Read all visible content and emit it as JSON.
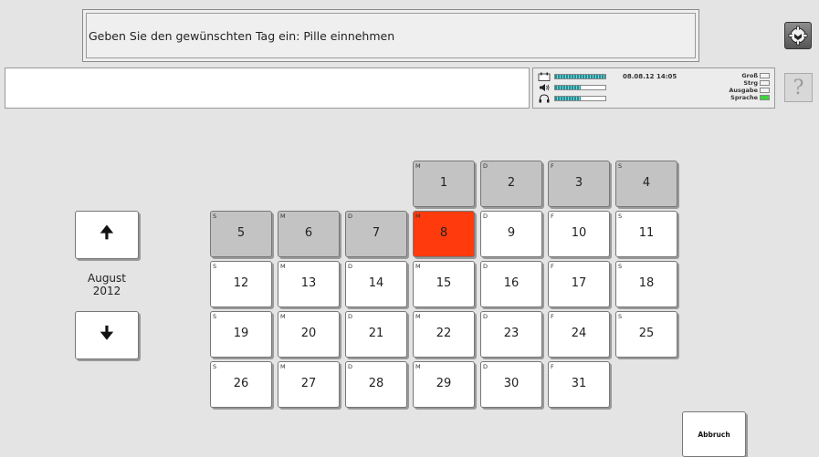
{
  "prompt": "Geben Sie den gewünschten Tag ein: Pille einnehmen",
  "status": {
    "datetime": "08.08.12 14:05",
    "levels": [
      {
        "icon": "calendar-icon",
        "value": 1.0
      },
      {
        "icon": "speaker-icon",
        "value": 0.5
      },
      {
        "icon": "headphones-icon",
        "value": 0.5
      }
    ],
    "flags": [
      {
        "label": "Groß",
        "on": false
      },
      {
        "label": "Strg",
        "on": false
      },
      {
        "label": "Ausgabe",
        "on": false
      },
      {
        "label": "Sprache",
        "on": true
      }
    ]
  },
  "help_label": "?",
  "nav": {
    "up_arrow": "🠉",
    "down_arrow": "🠋",
    "month": "August",
    "year": "2012"
  },
  "calendar": {
    "days": [
      {
        "num": "1",
        "dn": "M",
        "state": "prev"
      },
      {
        "num": "2",
        "dn": "D",
        "state": "prev"
      },
      {
        "num": "3",
        "dn": "F",
        "state": "prev"
      },
      {
        "num": "4",
        "dn": "S",
        "state": "prev"
      },
      {
        "num": "5",
        "dn": "S",
        "state": "prev"
      },
      {
        "num": "6",
        "dn": "M",
        "state": "prev"
      },
      {
        "num": "7",
        "dn": "D",
        "state": "prev"
      },
      {
        "num": "8",
        "dn": "M",
        "state": "today"
      },
      {
        "num": "9",
        "dn": "D",
        "state": "normal"
      },
      {
        "num": "10",
        "dn": "F",
        "state": "normal"
      },
      {
        "num": "11",
        "dn": "S",
        "state": "normal"
      },
      {
        "num": "12",
        "dn": "S",
        "state": "normal"
      },
      {
        "num": "13",
        "dn": "M",
        "state": "normal"
      },
      {
        "num": "14",
        "dn": "D",
        "state": "normal"
      },
      {
        "num": "15",
        "dn": "M",
        "state": "normal"
      },
      {
        "num": "16",
        "dn": "D",
        "state": "normal"
      },
      {
        "num": "17",
        "dn": "F",
        "state": "normal"
      },
      {
        "num": "18",
        "dn": "S",
        "state": "normal"
      },
      {
        "num": "19",
        "dn": "S",
        "state": "normal"
      },
      {
        "num": "20",
        "dn": "M",
        "state": "normal"
      },
      {
        "num": "21",
        "dn": "D",
        "state": "normal"
      },
      {
        "num": "22",
        "dn": "M",
        "state": "normal"
      },
      {
        "num": "23",
        "dn": "D",
        "state": "normal"
      },
      {
        "num": "24",
        "dn": "F",
        "state": "normal"
      },
      {
        "num": "25",
        "dn": "S",
        "state": "normal"
      },
      {
        "num": "26",
        "dn": "S",
        "state": "normal"
      },
      {
        "num": "27",
        "dn": "M",
        "state": "normal"
      },
      {
        "num": "28",
        "dn": "D",
        "state": "normal"
      },
      {
        "num": "29",
        "dn": "M",
        "state": "normal"
      },
      {
        "num": "30",
        "dn": "D",
        "state": "normal"
      },
      {
        "num": "31",
        "dn": "F",
        "state": "normal"
      }
    ]
  },
  "cancel_label": "Abbruch",
  "colors": {
    "today": "#ff3a0d",
    "prev_day": "#c3c3c3",
    "led_on": "#3bd43b"
  }
}
